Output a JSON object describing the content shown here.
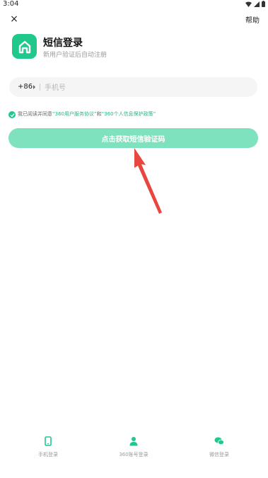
{
  "status": {
    "time": "3:04"
  },
  "header": {
    "close_label": "×",
    "help_label": "帮助"
  },
  "login": {
    "title": "短信登录",
    "subtitle": "新用户验证后自动注册"
  },
  "phone": {
    "country_code": "+86",
    "placeholder": "手机号"
  },
  "agreement": {
    "prefix": "我已阅读并同意",
    "link1": "“360用户服务协议”",
    "and": "和",
    "link2": "“360个人信息保护政策”"
  },
  "sms_button": {
    "label": "点击获取短信验证码"
  },
  "bottom_nav": [
    {
      "label": "手机登录"
    },
    {
      "label": "360账号登录"
    },
    {
      "label": "微信登录"
    }
  ],
  "colors": {
    "brand": "#21c88b",
    "button": "#7fe2bf",
    "arrow": "#e8463f"
  }
}
